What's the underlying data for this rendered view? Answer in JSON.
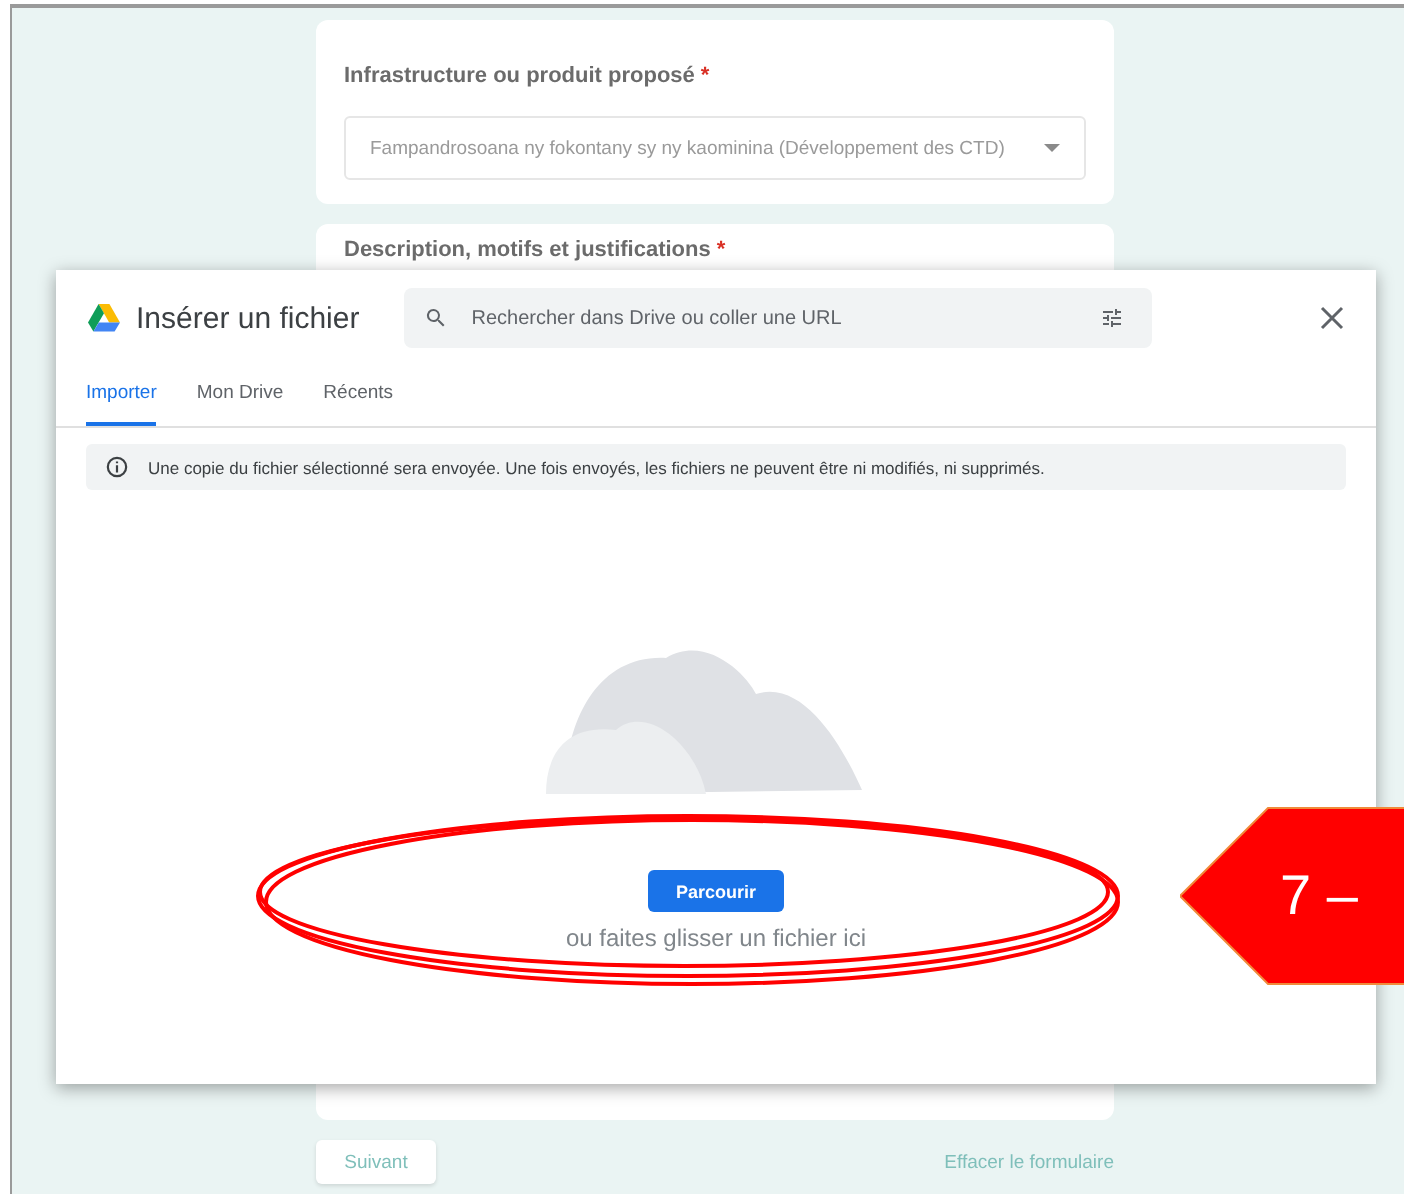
{
  "form": {
    "questions": [
      {
        "label": "Infrastructure ou produit proposé",
        "required_mark": "*",
        "value": "Fampandrosoana ny fokontany sy ny kaominina (Développement des CTD)"
      },
      {
        "label": "Description, motifs et justifications",
        "required_mark": "*"
      }
    ],
    "next_button": "Suivant",
    "clear_link": "Effacer le formulaire"
  },
  "dialog": {
    "title": "Insérer un fichier",
    "search": {
      "placeholder": "Rechercher dans Drive ou coller une URL"
    },
    "tabs": [
      {
        "label": "Importer",
        "selected": true
      },
      {
        "label": "Mon Drive",
        "selected": false
      },
      {
        "label": "Récents",
        "selected": false
      }
    ],
    "notice": "Une copie du fichier sélectionné sera envoyée. Une fois envoyés, les fichiers ne peuvent être ni modifiés, ni supprimés.",
    "browse_button": "Parcourir",
    "drop_hint": "ou faites glisser un fichier ici"
  },
  "callout": {
    "label": "7 –"
  }
}
